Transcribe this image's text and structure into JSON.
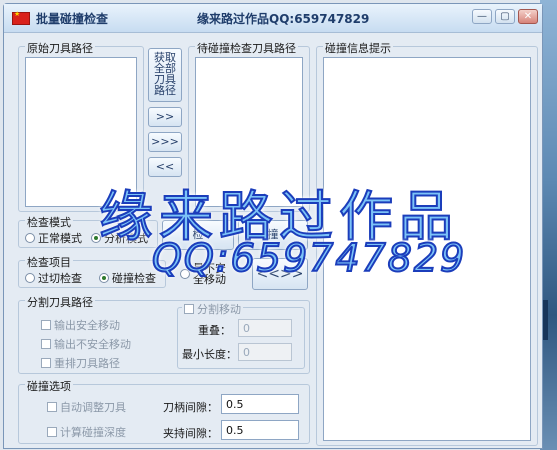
{
  "window": {
    "title": "批量碰撞检查",
    "subtitle": "缘来路过作品QQ:659747829",
    "controls": {
      "minimize": "—",
      "maximize": "▢",
      "close": "✕"
    }
  },
  "source_paths": {
    "legend": "原始刀具路径"
  },
  "pending_paths": {
    "legend": "待碰撞检查刀具路径"
  },
  "collision_info": {
    "legend": "碰撞信息提示"
  },
  "transfer_buttons": {
    "get_all": "获取\n全部\n刀具\n路径",
    "move_right": ">>",
    "move_all_right": ">>>",
    "move_left": "<<",
    "check": "检",
    "check_tail": "查",
    "collide_tail": "撞"
  },
  "check_mode": {
    "legend": "检查模式",
    "options": [
      "正常模式",
      "分析模式"
    ],
    "selected": 1
  },
  "check_items": {
    "legend": "检查项目",
    "options": [
      "过切检查",
      "碰撞检查"
    ],
    "selected": 1,
    "extra_option": "最不安\n全移动",
    "swap_button": "<<>>"
  },
  "split_paths": {
    "legend": "分割刀具路径",
    "options": [
      "输出安全移动",
      "输出不安全移动",
      "重排刀具路径"
    ],
    "split_move": {
      "label": "分割移动",
      "overlap_label": "重叠：",
      "overlap_value": "0",
      "min_length_label": "最小长度：",
      "min_length_value": "0"
    }
  },
  "collision_options": {
    "legend": "碰撞选项",
    "auto_adjust": "自动调整刀具",
    "calc_depth": "计算碰撞深度",
    "shank_gap_label": "刀柄间隙：",
    "shank_gap_value": "0.5",
    "holder_gap_label": "夹持间隙：",
    "holder_gap_value": "0.5"
  },
  "watermark": {
    "line1": "缘来路过作品",
    "line2": "QQ:659747829"
  }
}
